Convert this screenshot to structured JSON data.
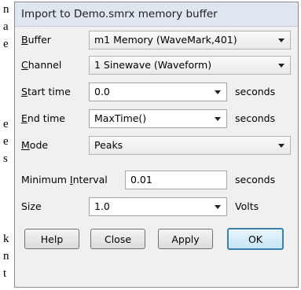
{
  "background_text": [
    "n",
    "a",
    "e",
    "",
    "e",
    "e",
    "s",
    "",
    "k",
    "n",
    "t"
  ],
  "dialog": {
    "title": "Import to Demo.smrx memory buffer",
    "buffer": {
      "label_u": "B",
      "label_rest": "uffer",
      "value": "m1 Memory (WaveMark,401)"
    },
    "channel": {
      "label_u": "C",
      "label_rest": "hannel",
      "value": "1 Sinewave (Waveform)"
    },
    "start_time": {
      "label_u": "S",
      "label_rest": "tart time",
      "value": "0.0",
      "unit": "seconds"
    },
    "end_time": {
      "label_u": "E",
      "label_rest": "nd time",
      "value": "MaxTime()",
      "unit": "seconds"
    },
    "mode": {
      "label_u": "M",
      "label_rest": "ode",
      "value": "Peaks"
    },
    "min_interval": {
      "label_pre": "Minimum ",
      "label_u": "I",
      "label_rest": "nterval",
      "value": "0.01",
      "unit": "seconds"
    },
    "size": {
      "label": "Size",
      "value": "1.0",
      "unit": "Volts"
    },
    "buttons": {
      "help": "Help",
      "close": "Close",
      "apply": "Apply",
      "ok": "OK"
    }
  }
}
